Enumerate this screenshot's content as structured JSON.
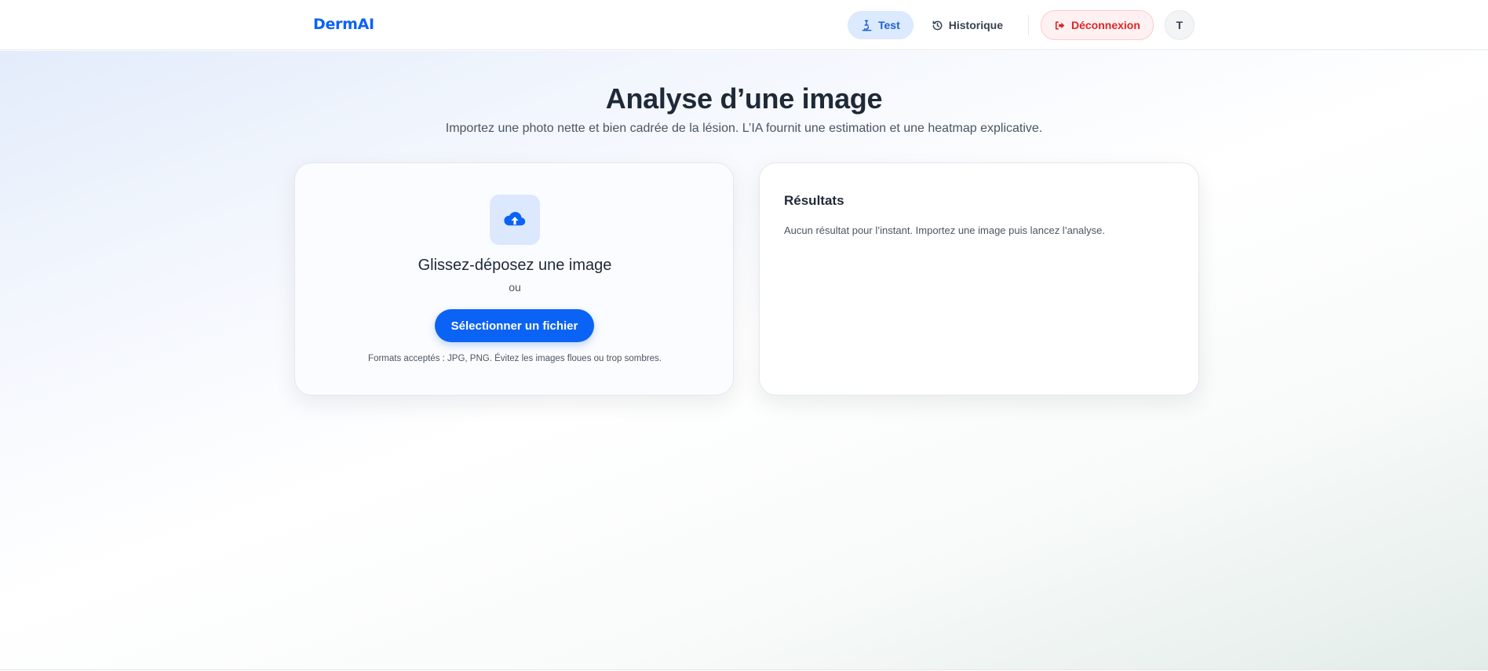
{
  "header": {
    "logo": "DermAI",
    "nav": {
      "test_label": "Test",
      "history_label": "Historique",
      "logout_label": "Déconnexion"
    },
    "avatar_initial": "T"
  },
  "main": {
    "title": "Analyse d’une image",
    "subtitle": "Importez une photo nette et bien cadrée de la lésion. L’IA fournit une estimation et une heatmap explicative."
  },
  "upload": {
    "drop_title": "Glissez-déposez une image",
    "or_text": "ou",
    "select_button": "Sélectionner un fichier",
    "formats_note": "Formats acceptés : JPG, PNG. Évitez les images floues ou trop sombres."
  },
  "results": {
    "title": "Résultats",
    "empty_message": "Aucun résultat pour l’instant. Importez une image puis lancez l’analyse."
  },
  "colors": {
    "accent": "#0b63f6",
    "active_tab_bg": "#dbeafe",
    "logout_red": "#dc2626"
  },
  "icons": {
    "test": "microscope-icon",
    "history": "history-icon",
    "logout": "sign-out-icon",
    "upload": "cloud-upload-icon"
  }
}
